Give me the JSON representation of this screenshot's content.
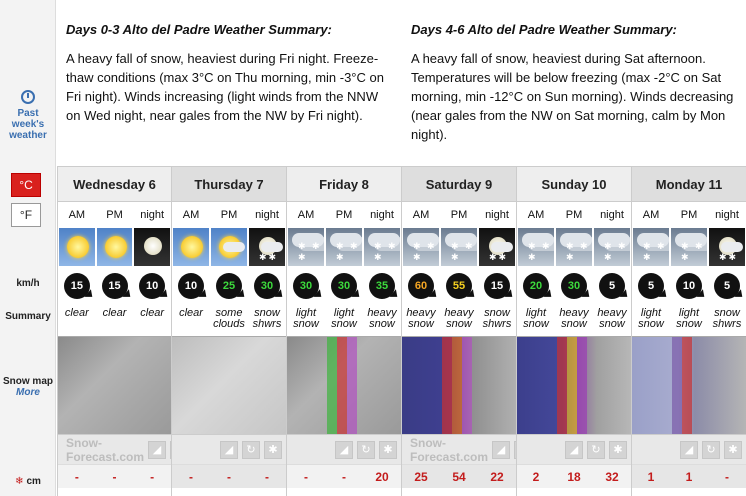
{
  "sidebar": {
    "past_week": "Past week's weather",
    "unit_c": "°C",
    "unit_f": "°F",
    "label_wind": "km/h",
    "label_summary": "Summary",
    "label_snowmap": "Snow map",
    "label_more": "More",
    "label_snow": "cm",
    "snow_icon": "❄"
  },
  "summary": {
    "left": {
      "title": "Days 0-3 Alto del Padre Weather Summary:",
      "text": "A heavy fall of snow, heaviest during Fri night. Freeze-thaw conditions (max 3°C on Thu morning, min -3°C on Fri night). Winds increasing (light winds from the NNW on Wed night, near gales from the NW by Fri night)."
    },
    "right": {
      "title": "Days 4-6 Alto del Padre Weather Summary:",
      "text": "A heavy fall of snow, heaviest during Sat afternoon. Temperatures will be below freezing (max -2°C on Sat morning, min -12°C on Sun morning). Winds decreasing (near gales from the NW on Sat morning, calm by Mon night)."
    }
  },
  "periods": [
    "AM",
    "PM",
    "night"
  ],
  "brand": "Snow-Forecast.com",
  "days": [
    {
      "name": "Wednesday 6",
      "icons": [
        "sun",
        "sun",
        "moon"
      ],
      "winds": [
        {
          "v": "15",
          "c": "#ffffff"
        },
        {
          "v": "15",
          "c": "#ffffff"
        },
        {
          "v": "10",
          "c": "#ffffff"
        }
      ],
      "descs": [
        "clear",
        "clear",
        "clear"
      ],
      "snow": [
        "-",
        "-",
        "-"
      ]
    },
    {
      "name": "Thursday 7",
      "icons": [
        "sun",
        "sun-cloud",
        "moon-cloud"
      ],
      "winds": [
        {
          "v": "10",
          "c": "#ffffff"
        },
        {
          "v": "25",
          "c": "#3cd93c"
        },
        {
          "v": "30",
          "c": "#3cd93c"
        }
      ],
      "descs": [
        "clear",
        "some clouds",
        "snow shwrs"
      ],
      "snow": [
        "-",
        "-",
        "-"
      ]
    },
    {
      "name": "Friday 8",
      "icons": [
        "snow",
        "snow",
        "snow"
      ],
      "winds": [
        {
          "v": "30",
          "c": "#3cd93c"
        },
        {
          "v": "30",
          "c": "#3cd93c"
        },
        {
          "v": "35",
          "c": "#3cd93c"
        }
      ],
      "descs": [
        "light snow",
        "light snow",
        "heavy snow"
      ],
      "snow": [
        "-",
        "-",
        "20"
      ]
    },
    {
      "name": "Saturday 9",
      "icons": [
        "snow",
        "snow",
        "moon-cloud"
      ],
      "winds": [
        {
          "v": "60",
          "c": "#f5a623"
        },
        {
          "v": "55",
          "c": "#f5d020"
        },
        {
          "v": "15",
          "c": "#ffffff"
        }
      ],
      "descs": [
        "heavy snow",
        "heavy snow",
        "snow shwrs"
      ],
      "snow": [
        "25",
        "54",
        "22"
      ]
    },
    {
      "name": "Sunday 10",
      "icons": [
        "snow",
        "snow",
        "snow"
      ],
      "winds": [
        {
          "v": "20",
          "c": "#3cd93c"
        },
        {
          "v": "30",
          "c": "#3cd93c"
        },
        {
          "v": "5",
          "c": "#ffffff"
        }
      ],
      "descs": [
        "light snow",
        "heavy snow",
        "heavy snow"
      ],
      "snow": [
        "2",
        "18",
        "32"
      ]
    },
    {
      "name": "Monday 11",
      "icons": [
        "snow",
        "snow",
        "moon-cloud"
      ],
      "winds": [
        {
          "v": "5",
          "c": "#ffffff"
        },
        {
          "v": "10",
          "c": "#ffffff"
        },
        {
          "v": "5",
          "c": "#ffffff"
        }
      ],
      "descs": [
        "light snow",
        "light snow",
        "snow shwrs"
      ],
      "snow": [
        "1",
        "1",
        "-"
      ]
    }
  ]
}
